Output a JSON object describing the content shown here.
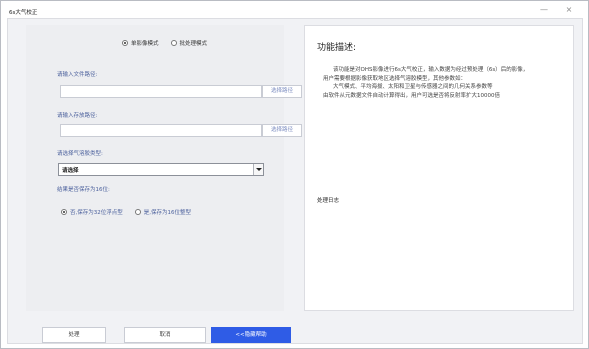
{
  "window": {
    "title": "6s大气校正",
    "minimize_glyph": "—",
    "close_glyph": "×"
  },
  "mode": {
    "options": [
      {
        "label": "单影像模式",
        "selected": true
      },
      {
        "label": "批处理模式",
        "selected": false
      }
    ]
  },
  "form": {
    "input_label": "请输入文件路径:",
    "input_value": "",
    "input_browse": "选择路径",
    "output_label": "请输入存放路径:",
    "output_value": "",
    "output_browse": "选择路径",
    "type_label": "请选择气溶胶类型:",
    "type_selected": "请选择",
    "save_label": "结果是否保存为16位:",
    "save_options": [
      {
        "label": "否,保存为32位浮点型",
        "selected": true
      },
      {
        "label": "是,保存为16位整型",
        "selected": false
      }
    ]
  },
  "help": {
    "title": "功能描述:",
    "lines": [
      "该功能是对OHS影像进行6s大气校正，输入数据为经过预处理（6s）后的影像，",
      "用户需要根据影像获取地区选择气溶胶模型，其他参数如：",
      "大气模式、平均海拔、太阳和卫星与传感器之间的几何关系参数等",
      "由软件从元数据文件自动计算得出，用户可选是否将反射率扩大10000倍"
    ],
    "log_title": "处理日志"
  },
  "buttons": {
    "run": "处理",
    "cancel": "取消",
    "help": "<<隐藏帮助"
  },
  "colors": {
    "accent": "#2f5ce6",
    "label_blue": "#4a5f9c",
    "panel_bg": "#edeef1"
  }
}
